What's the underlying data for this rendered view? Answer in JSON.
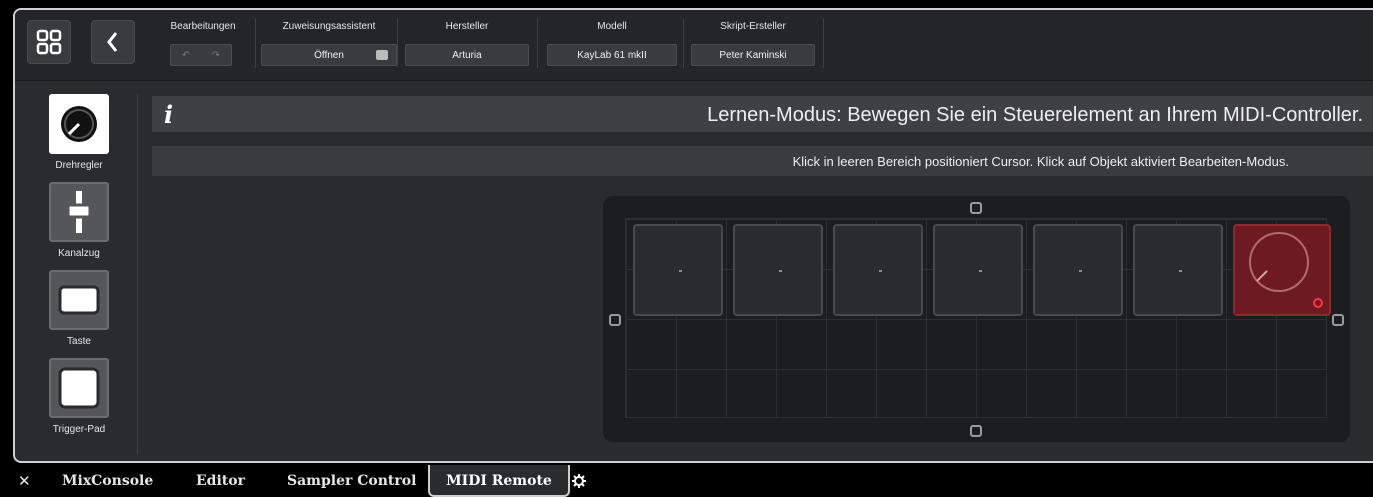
{
  "toolbar": {
    "undo_group": {
      "label": "Bearbeitungen",
      "undo_icon": "undo-icon",
      "redo_icon": "redo-icon"
    },
    "assistant": {
      "label": "Zuweisungsassistent",
      "value": "Öffnen"
    },
    "manufacturer": {
      "label": "Hersteller",
      "value": "Arturia"
    },
    "model": {
      "label": "Modell",
      "value": "KayLab 61 mkII"
    },
    "script_creator": {
      "label": "Skript-Ersteller",
      "value": "Peter Kaminski"
    }
  },
  "sidebar": {
    "tools": [
      {
        "label": "Drehregler",
        "icon": "knob-icon"
      },
      {
        "label": "Kanalzug",
        "icon": "fader-icon"
      },
      {
        "label": "Taste",
        "icon": "button-icon"
      },
      {
        "label": "Trigger-Pad",
        "icon": "pad-icon"
      }
    ]
  },
  "info": {
    "icon": "i",
    "message": "Lernen-Modus: Bewegen Sie ein Steuerelement an Ihrem MIDI-Controller."
  },
  "hint": {
    "message": "Klick in leeren Bereich positioniert Cursor. Klick auf Objekt aktiviert Bearbeiten-Modus."
  },
  "canvas": {
    "controls": [
      "knob",
      "knob",
      "knob",
      "knob",
      "knob",
      "knob",
      "knob-selected"
    ],
    "accent": "#6e1a22"
  },
  "tabs": {
    "close": "✕",
    "items": [
      "MixConsole",
      "Editor",
      "Sampler Control",
      "MIDI Remote"
    ],
    "active": "MIDI Remote",
    "settings_icon": "gear-icon"
  }
}
